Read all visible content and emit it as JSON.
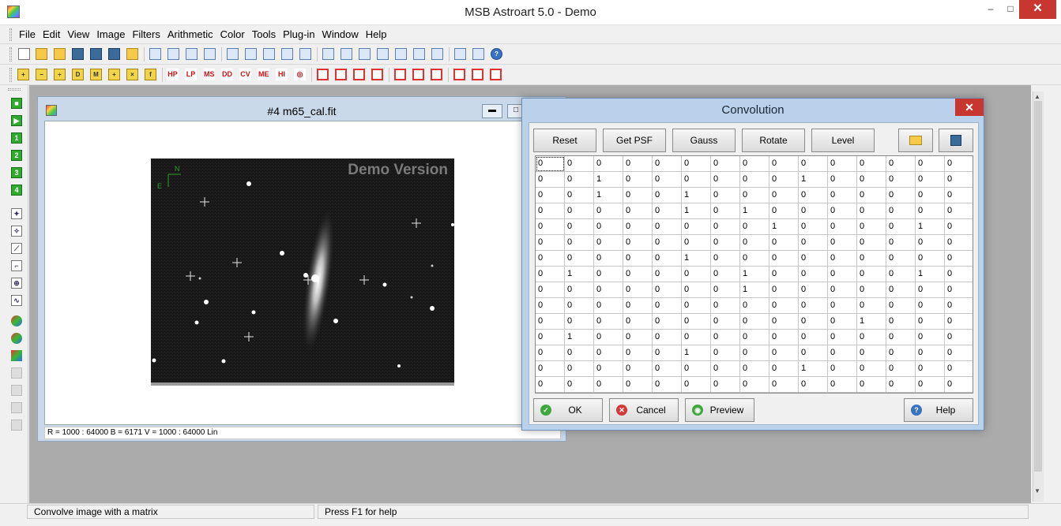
{
  "app": {
    "title": "MSB Astroart 5.0 - Demo",
    "minimize": "–",
    "maximize": "□",
    "close": "✕"
  },
  "menu": [
    "File",
    "Edit",
    "View",
    "Image",
    "Filters",
    "Arithmetic",
    "Color",
    "Tools",
    "Plug-in",
    "Window",
    "Help"
  ],
  "toolbar2_labels": [
    "HP",
    "LP",
    "MS",
    "DD",
    "CV",
    "ME",
    "HI"
  ],
  "image_window": {
    "title": "#4 m65_cal.fit",
    "watermark": "Demo Version",
    "north": "N",
    "east": "E",
    "status": "R = 1000 : 64000    B = 6171    V = 1000 : 64000 Lin"
  },
  "dialog": {
    "title": "Convolution",
    "buttons": {
      "reset": "Reset",
      "get_psf": "Get PSF",
      "gauss": "Gauss",
      "rotate": "Rotate",
      "level": "Level",
      "ok": "OK",
      "cancel": "Cancel",
      "preview": "Preview",
      "help": "Help"
    },
    "matrix": [
      [
        0,
        0,
        0,
        0,
        0,
        0,
        0,
        0,
        0,
        0,
        0,
        0,
        0,
        0,
        0
      ],
      [
        0,
        0,
        1,
        0,
        0,
        0,
        0,
        0,
        0,
        1,
        0,
        0,
        0,
        0,
        0
      ],
      [
        0,
        0,
        1,
        0,
        0,
        1,
        0,
        0,
        0,
        0,
        0,
        0,
        0,
        0,
        0
      ],
      [
        0,
        0,
        0,
        0,
        0,
        1,
        0,
        1,
        0,
        0,
        0,
        0,
        0,
        0,
        0
      ],
      [
        0,
        0,
        0,
        0,
        0,
        0,
        0,
        0,
        1,
        0,
        0,
        0,
        0,
        1,
        0
      ],
      [
        0,
        0,
        0,
        0,
        0,
        0,
        0,
        0,
        0,
        0,
        0,
        0,
        0,
        0,
        0
      ],
      [
        0,
        0,
        0,
        0,
        0,
        1,
        0,
        0,
        0,
        0,
        0,
        0,
        0,
        0,
        0
      ],
      [
        0,
        1,
        0,
        0,
        0,
        0,
        0,
        1,
        0,
        0,
        0,
        0,
        0,
        1,
        0
      ],
      [
        0,
        0,
        0,
        0,
        0,
        0,
        0,
        1,
        0,
        0,
        0,
        0,
        0,
        0,
        0
      ],
      [
        0,
        0,
        0,
        0,
        0,
        0,
        0,
        0,
        0,
        0,
        0,
        0,
        0,
        0,
        0
      ],
      [
        0,
        0,
        0,
        0,
        0,
        0,
        0,
        0,
        0,
        0,
        0,
        1,
        0,
        0,
        0
      ],
      [
        0,
        1,
        0,
        0,
        0,
        0,
        0,
        0,
        0,
        0,
        0,
        0,
        0,
        0,
        0
      ],
      [
        0,
        0,
        0,
        0,
        0,
        1,
        0,
        0,
        0,
        0,
        0,
        0,
        0,
        0,
        0
      ],
      [
        0,
        0,
        0,
        0,
        0,
        0,
        0,
        0,
        0,
        1,
        0,
        0,
        0,
        0,
        0
      ],
      [
        0,
        0,
        0,
        0,
        0,
        0,
        0,
        0,
        0,
        0,
        0,
        0,
        0,
        0,
        0
      ]
    ]
  },
  "status": {
    "left": "Convolve image with a matrix",
    "right": "Press F1 for help"
  }
}
